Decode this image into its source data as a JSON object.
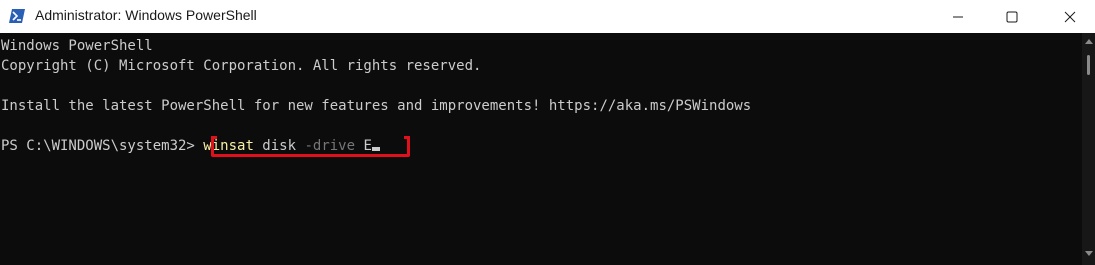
{
  "window": {
    "title": "Administrator: Windows PowerShell",
    "icon": "powershell-icon",
    "controls": [
      "minimize-icon",
      "maximize-icon",
      "close-icon"
    ]
  },
  "terminal": {
    "lines": [
      "Windows PowerShell",
      "Copyright (C) Microsoft Corporation. All rights reserved.",
      "",
      "Install the latest PowerShell for new features and improvements! https://aka.ms/PSWindows",
      ""
    ],
    "prompt": "PS C:\\WINDOWS\\system32> ",
    "command": {
      "name": "winsat",
      "sub": " disk",
      "param": " -drive",
      "arg": " E"
    }
  },
  "colors": {
    "background": "#0c0c0c",
    "text": "#cccccc",
    "command": "#f9f1a5",
    "parameter": "#767676",
    "highlight": "#e0101c",
    "titlebar": "#ffffff"
  }
}
